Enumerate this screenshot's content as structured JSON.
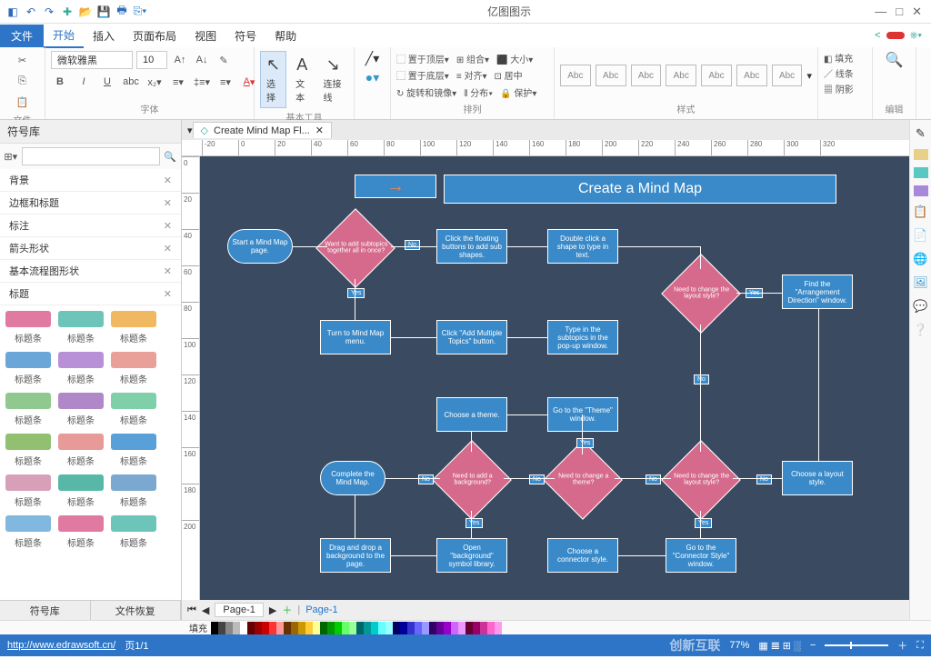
{
  "app": {
    "title": "亿图图示"
  },
  "menu": {
    "file": "文件",
    "tabs": [
      "开始",
      "插入",
      "页面布局",
      "视图",
      "符号",
      "帮助"
    ],
    "active": 0
  },
  "ribbon": {
    "clipboard_label": "文件",
    "font_label": "字体",
    "font_name": "微软雅黑",
    "font_size": "10",
    "tools_label": "基本工具",
    "select": "选择",
    "text": "文本",
    "connector": "连接线",
    "arrange_label": "排列",
    "arrange_items": [
      "置于顶层",
      "置于底层",
      "旋转和镜像",
      "组合",
      "对齐",
      "分布",
      "大小",
      "居中",
      "保护"
    ],
    "style_label": "样式",
    "abc": "Abc",
    "edit_label": "编辑",
    "fill": "填充",
    "line": "线条",
    "shadow": "阴影"
  },
  "doc_tab": "Create Mind Map Fl...",
  "ruler_marks": [
    "-20",
    "0",
    "20",
    "40",
    "60",
    "80",
    "100",
    "120",
    "140",
    "160",
    "180",
    "200",
    "220",
    "240",
    "260",
    "280",
    "300",
    "320"
  ],
  "ruler_v": [
    "0",
    "20",
    "40",
    "60",
    "80",
    "100",
    "120",
    "140",
    "160",
    "180",
    "200"
  ],
  "sidebar": {
    "header": "符号库",
    "categories": [
      "背景",
      "边框和标题",
      "标注",
      "箭头形状",
      "基本流程图形状",
      "标题"
    ],
    "shape_label": "标题条",
    "tabs": [
      "符号库",
      "文件恢复"
    ]
  },
  "shape_colors": [
    "#e07aa0",
    "#6cc5b8",
    "#f0b860",
    "#6aa7d8",
    "#b890d8",
    "#e8a098",
    "#8fc98f",
    "#b088c8",
    "#7fcfa8",
    "#90c070",
    "#e89a98",
    "#5aa0d8",
    "#d8a0b8",
    "#58b8a8",
    "#7aa8d0",
    "#80b8e0"
  ],
  "page_tabs": {
    "page": "Page-1",
    "fill_label": "填充"
  },
  "status": {
    "url": "http://www.edrawsoft.cn/",
    "page": "页1/1",
    "zoom": "77%"
  },
  "color_palette": [
    "#000",
    "#444",
    "#888",
    "#bbb",
    "#fff",
    "#600",
    "#900",
    "#c00",
    "#f33",
    "#f99",
    "#630",
    "#960",
    "#c90",
    "#fc3",
    "#ff9",
    "#060",
    "#090",
    "#0c0",
    "#6f6",
    "#9f9",
    "#066",
    "#099",
    "#0cc",
    "#6ff",
    "#9ff",
    "#006",
    "#009",
    "#33c",
    "#66f",
    "#99f",
    "#306",
    "#609",
    "#90c",
    "#c6f",
    "#e9f",
    "#603",
    "#906",
    "#c39",
    "#f6c",
    "#f9e"
  ],
  "flowchart": {
    "title": "Create a Mind Map",
    "nodes": {
      "start": "Start a Mind Map page.",
      "d1": "Want to add subtopics together all in once?",
      "n1": "Click the floating buttons to add sub shapes.",
      "n2": "Double click a shape to type in text.",
      "n3": "Turn to Mind Map menu.",
      "n4": "Click \"Add Multiple Topics\" button.",
      "n5": "Type in the subtopics in the pop-up window.",
      "d2": "Need to change the layout style?",
      "n6": "Find the \"Arrangement Direction\" window.",
      "n7": "Choose a theme.",
      "n8": "Go to the \"Theme\" window.",
      "end": "Complete the Mind Map.",
      "d3": "Need to add a background?",
      "d4": "Need to change a theme?",
      "d5": "Need to change the layout style?",
      "n9": "Choose a layout style.",
      "n10": "Drag and drop a background to the page.",
      "n11": "Open \"background\" symbol library.",
      "n12": "Choose a connector style.",
      "n13": "Go to the \"Connector Style\" window."
    },
    "labels": {
      "yes": "Yes",
      "no": "No"
    }
  },
  "watermark": "创新互联"
}
